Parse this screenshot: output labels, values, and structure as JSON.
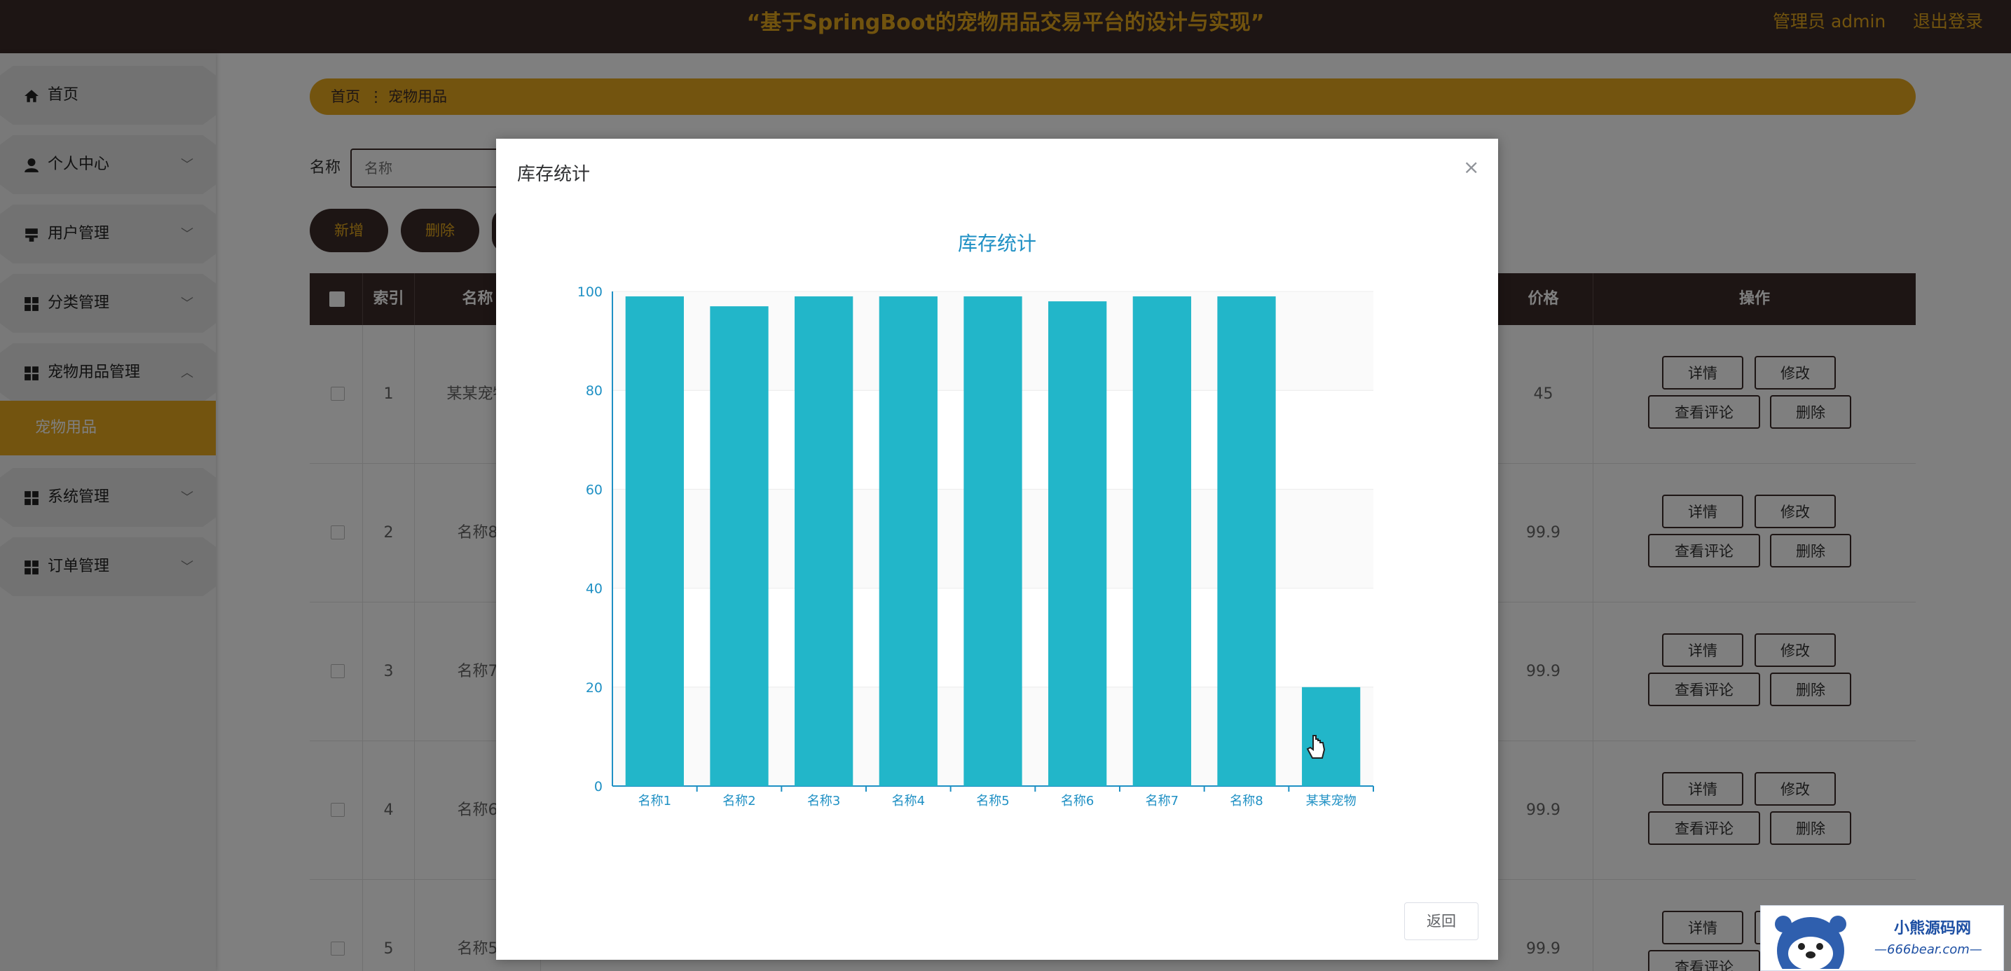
{
  "header": {
    "title": "“基于SpringBoot的宠物用品交易平台的设计与实现”",
    "admin": "管理员 admin",
    "logout": "退出登录"
  },
  "sidebar": {
    "items": [
      {
        "label": "首页",
        "icon": "home-icon"
      },
      {
        "label": "个人中心",
        "icon": "user-icon"
      },
      {
        "label": "用户管理",
        "icon": "user-admin-icon"
      },
      {
        "label": "分类管理",
        "icon": "grid-icon"
      },
      {
        "label": "宠物用品管理",
        "icon": "grid-icon"
      },
      {
        "label": "系统管理",
        "icon": "grid-icon"
      },
      {
        "label": "订单管理",
        "icon": "grid-icon"
      }
    ],
    "active_sub": "宠物用品"
  },
  "breadcrumb": {
    "home": "首页",
    "separator": "⋮",
    "current": "宠物用品"
  },
  "search": {
    "label": "名称",
    "placeholder": "名称"
  },
  "toolbar": {
    "add": "新增",
    "delete": "删除"
  },
  "table": {
    "headers": {
      "index": "索引",
      "name": "名称",
      "price": "价格",
      "ops": "操作"
    },
    "rows": [
      {
        "index": "1",
        "name": "某某宠物",
        "price": "45"
      },
      {
        "index": "2",
        "name": "名称8",
        "price": "99.9"
      },
      {
        "index": "3",
        "name": "名称7",
        "price": "99.9"
      },
      {
        "index": "4",
        "name": "名称6",
        "price": "99.9"
      },
      {
        "index": "5",
        "name": "名称5",
        "price": "99.9"
      }
    ],
    "row_buttons": {
      "detail": "详情",
      "edit": "修改",
      "comments": "查看评论",
      "delete": "删除"
    }
  },
  "modal": {
    "title": "库存统计",
    "close": "×",
    "back": "返回"
  },
  "colors": {
    "dark": "#3a2a28",
    "accent": "#e7a91e",
    "bar": "#22b6c9",
    "axis": "#1f90c4"
  },
  "chart_data": {
    "type": "bar",
    "title": "库存统计",
    "categories": [
      "名称1",
      "名称2",
      "名称3",
      "名称4",
      "名称5",
      "名称6",
      "名称7",
      "名称8",
      "某某宠物"
    ],
    "values": [
      99,
      97,
      99,
      99,
      99,
      98,
      99,
      99,
      20
    ],
    "ylim": [
      0,
      100
    ],
    "yticks": [
      0,
      20,
      40,
      60,
      80,
      100
    ],
    "xlabel": "",
    "ylabel": ""
  },
  "watermark": {
    "cn": "小熊源码网",
    "url": "—666bear.com—"
  }
}
